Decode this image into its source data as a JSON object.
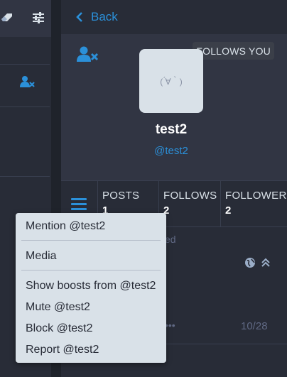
{
  "left_column": {
    "icons": [
      "eraser-icon",
      "sliders-icon",
      "user-times-icon"
    ]
  },
  "header": {
    "back_label": "Back"
  },
  "profile": {
    "follows_you_badge": "FOLLOWS YOU",
    "avatar_text": "( ́∀｀)",
    "display_name": "test2",
    "account": "@test2"
  },
  "stats": [
    {
      "label": "POSTS",
      "value": "1"
    },
    {
      "label": "FOLLOWS",
      "value": "2"
    },
    {
      "label": "FOLLOWER",
      "value": "2"
    }
  ],
  "timeline": {
    "fragment_text": "ed",
    "dots": "•••",
    "counter": "10/28"
  },
  "menu": {
    "items": [
      "Mention @test2",
      "Media",
      "Show boosts from @test2",
      "Mute @test2",
      "Block @test2",
      "Report @test2"
    ]
  },
  "colors": {
    "accent": "#2b90d9",
    "panel": "#282c37",
    "panel_light": "#313543",
    "menu_bg": "#d9e1e8"
  }
}
